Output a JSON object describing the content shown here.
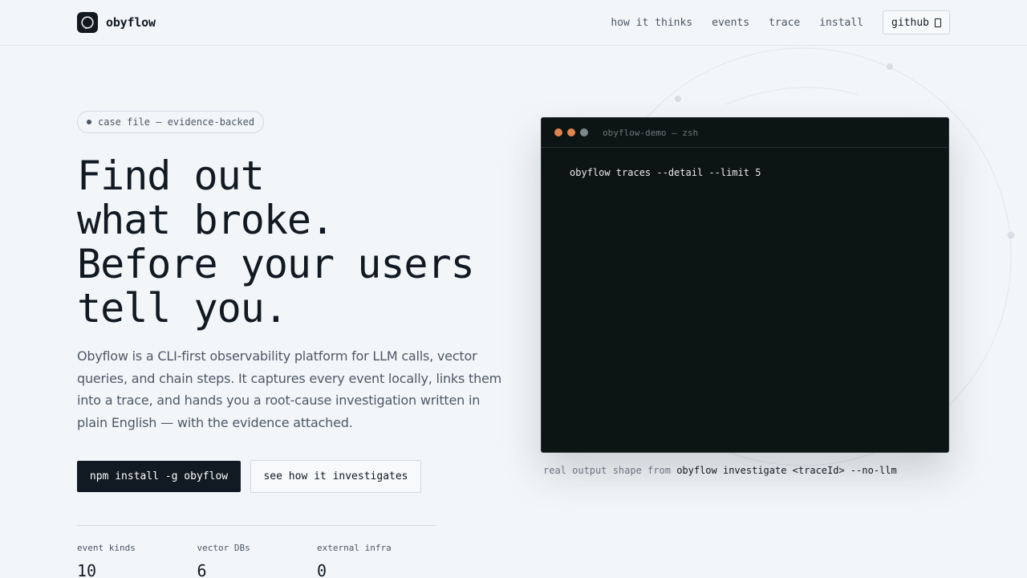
{
  "header": {
    "brand": "obyflow",
    "nav": [
      {
        "label": "how it thinks"
      },
      {
        "label": "events"
      },
      {
        "label": "trace"
      },
      {
        "label": "install"
      }
    ],
    "github_label": "github"
  },
  "hero": {
    "pill": "case file — evidence-backed",
    "headline": [
      "Find out",
      "what broke.",
      "Before your users",
      "tell you."
    ],
    "description": "Obyflow is a CLI-first observability platform for LLM calls, vector queries, and chain steps. It captures every event locally, links them into a trace, and hands you a root-cause investigation written in plain English — with the evidence attached.",
    "primary_button": "npm install -g obyflow",
    "secondary_button": "see how it investigates",
    "stats": [
      {
        "label": "event kinds",
        "value": "10"
      },
      {
        "label": "vector DBs",
        "value": "6"
      },
      {
        "label": "external infra",
        "value": "0"
      }
    ]
  },
  "terminal": {
    "title": "obyflow-demo — zsh",
    "command": "obyflow traces --detail --limit 5",
    "dots": [
      "#e0844e",
      "#e0844e",
      "#7d8a8a"
    ]
  },
  "caption": {
    "prefix": "real output shape from",
    "code": "obyflow investigate <traceId> --no-llm"
  },
  "colors": {
    "background": "#f3f6f9",
    "ink": "#111a22",
    "terminal_bg": "#0d1414"
  }
}
